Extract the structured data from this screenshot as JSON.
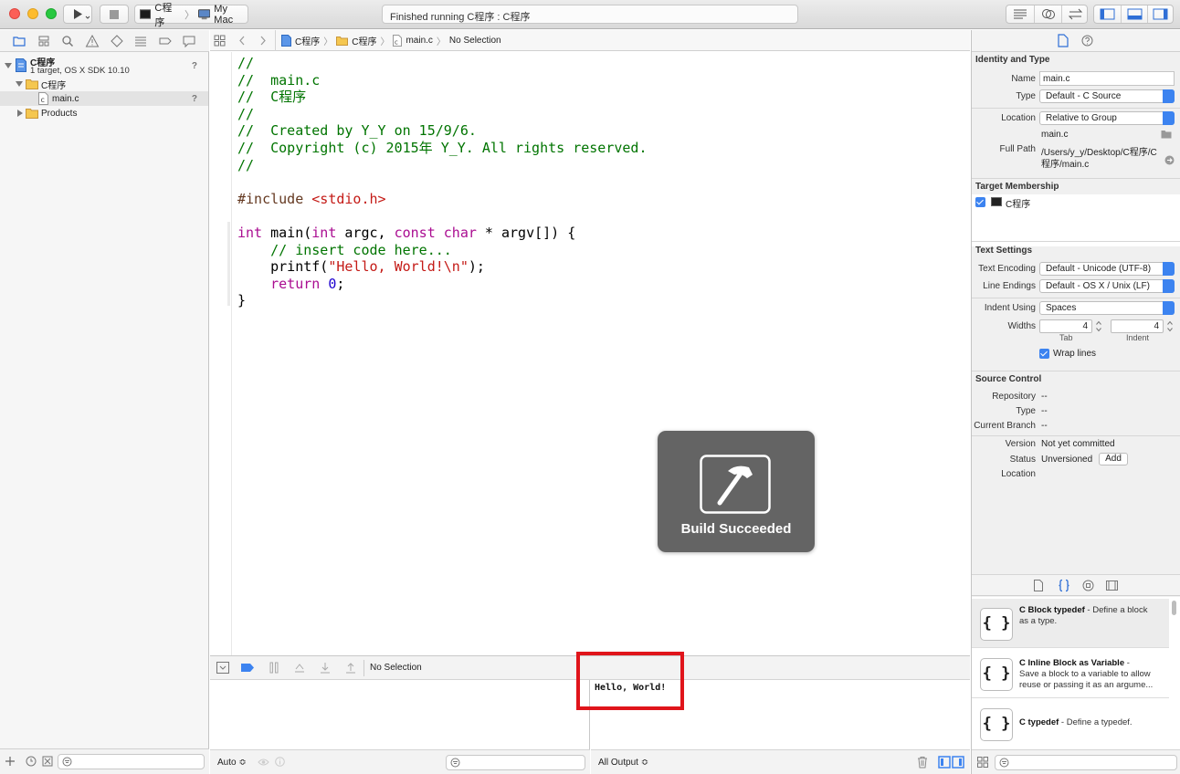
{
  "toolbar": {
    "scheme_target": "C程序",
    "scheme_device": "My Mac",
    "activity_status": "Finished running C程序 : C程序"
  },
  "navigator": {
    "project_name": "C程序",
    "project_subtitle": "1 target, OS X SDK 10.10",
    "project_badge": "?",
    "group_name": "C程序",
    "file_name": "main.c",
    "file_badge": "?",
    "products_group": "Products"
  },
  "jumpbar": {
    "items": [
      "C程序",
      "C程序",
      "main.c",
      "No Selection"
    ]
  },
  "code_lines": [
    "//",
    "//  main.c",
    "//  C程序",
    "//",
    "//  Created by Y_Y on 15/9/6.",
    "//  Copyright (c) 2015年 Y_Y. All rights reserved.",
    "//",
    "",
    "#include <stdio.h>",
    "",
    "int main(int argc, const char * argv[]) {",
    "    // insert code here...",
    "    printf(\"Hello, World!\\n\");",
    "    return 0;",
    "}"
  ],
  "hud": {
    "label": "Build Succeeded"
  },
  "debug": {
    "selection": "No Selection",
    "variables_scope": "Auto ≎",
    "console_output": "Hello, World!",
    "console_filter": "All Output ≎"
  },
  "inspector": {
    "identity": {
      "section_title": "Identity and Type",
      "name_label": "Name",
      "name_value": "main.c",
      "type_label": "Type",
      "type_value": "Default - C Source",
      "location_label": "Location",
      "location_value": "Relative to Group",
      "location_file": "main.c",
      "full_path_label": "Full Path",
      "full_path_value_1": "/Users/y_y/Desktop/C程序/C",
      "full_path_value_2": "程序/main.c"
    },
    "membership": {
      "section_title": "Target Membership",
      "target_name": "C程序"
    },
    "text_settings": {
      "section_title": "Text Settings",
      "encoding_label": "Text Encoding",
      "encoding_value": "Default - Unicode (UTF-8)",
      "endings_label": "Line Endings",
      "endings_value": "Default - OS X / Unix (LF)",
      "indent_using_label": "Indent Using",
      "indent_using_value": "Spaces",
      "widths_label": "Widths",
      "tab_value": "4",
      "tab_label": "Tab",
      "indent_value": "4",
      "indent_label": "Indent",
      "wrap_label": "Wrap lines"
    },
    "source_control": {
      "section_title": "Source Control",
      "repository_label": "Repository",
      "repository_value": "--",
      "type_label": "Type",
      "type_value": "--",
      "branch_label": "Current Branch",
      "branch_value": "--",
      "version_label": "Version",
      "version_value": "Not yet committed",
      "status_label": "Status",
      "status_value": "Unversioned",
      "add_button": "Add",
      "location_label": "Location"
    },
    "library": [
      {
        "title": "C Block typedef",
        "desc_1": " - Define a block",
        "desc_2": "as a type."
      },
      {
        "title": "C Inline Block as Variable",
        "desc_1": " -",
        "desc_2": "Save a block to a variable to allow",
        "desc_3": "reuse or passing it as an argume..."
      },
      {
        "title": "C typedef",
        "desc_1": " - Define a typedef."
      }
    ],
    "library_icon_glyph": "{ }"
  },
  "colors": {
    "accent": "#3c83f0",
    "comment": "#007400",
    "keyword": "#aa0d91",
    "string": "#c41a16",
    "number": "#1c00cf",
    "preprocessor": "#643820",
    "highlight_box": "#e0141b"
  }
}
